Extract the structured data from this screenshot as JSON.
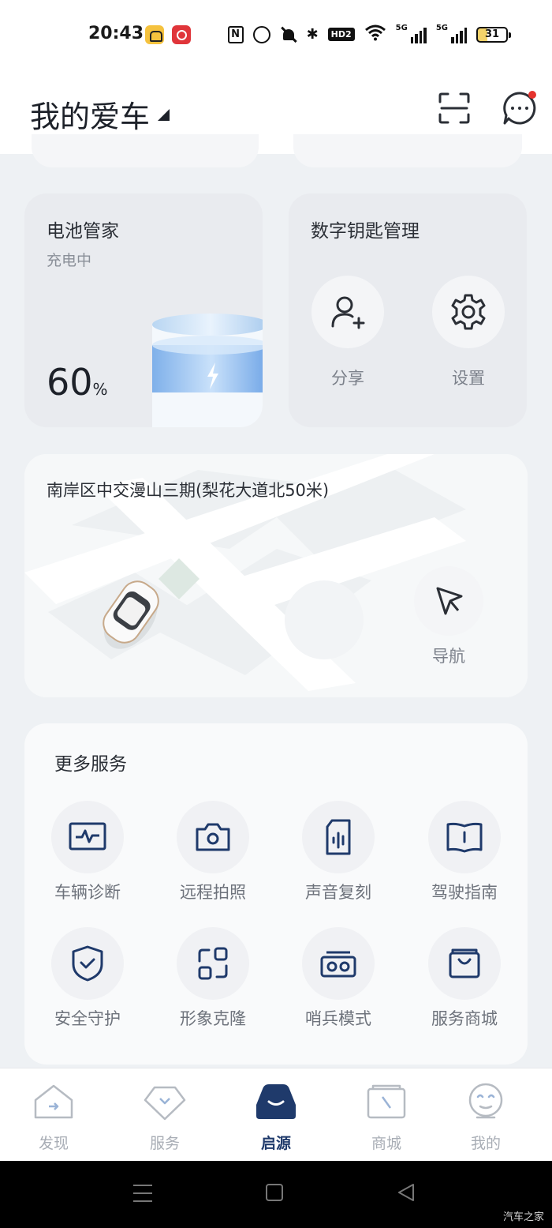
{
  "status_bar": {
    "time": "20:43",
    "nfc": "N",
    "hd_badge": "HD2",
    "net_5g_a": "5G",
    "net_5g_b": "5G",
    "battery": "31"
  },
  "header": {
    "title": "我的爱车"
  },
  "battery_card": {
    "title": "电池管家",
    "status": "充电中",
    "percent": "60",
    "unit": "%"
  },
  "key_card": {
    "title": "数字钥匙管理",
    "share_label": "分享",
    "settings_label": "设置"
  },
  "location_card": {
    "address": "南岸区中交漫山三期(梨花大道北50米)",
    "nav_label": "导航"
  },
  "more_services": {
    "title": "更多服务",
    "items": [
      {
        "label": "车辆诊断",
        "icon": "diagnosis-icon"
      },
      {
        "label": "远程拍照",
        "icon": "camera-icon"
      },
      {
        "label": "声音复刻",
        "icon": "voice-icon"
      },
      {
        "label": "驾驶指南",
        "icon": "guide-book-icon"
      },
      {
        "label": "安全守护",
        "icon": "shield-icon"
      },
      {
        "label": "形象克隆",
        "icon": "clone-icon"
      },
      {
        "label": "哨兵模式",
        "icon": "sentry-icon"
      },
      {
        "label": "服务商城",
        "icon": "shop-bag-icon"
      }
    ]
  },
  "bottom_nav": {
    "tabs": [
      {
        "label": "发现",
        "icon": "home-icon",
        "active": false
      },
      {
        "label": "服务",
        "icon": "service-icon",
        "active": false
      },
      {
        "label": "启源",
        "icon": "car-icon",
        "active": true
      },
      {
        "label": "商城",
        "icon": "mall-icon",
        "active": false
      },
      {
        "label": "我的",
        "icon": "profile-icon",
        "active": false
      }
    ]
  },
  "watermark": "汽车之家",
  "colors": {
    "accent": "#1f3a6b",
    "background": "#eef1f4",
    "notification_dot": "#e5332e"
  }
}
